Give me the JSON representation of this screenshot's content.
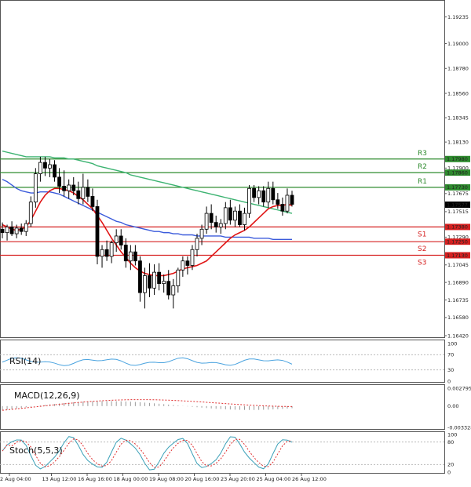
{
  "chart_data": {
    "type": "candlestick",
    "panes": {
      "price": {
        "ylim": [
          1.1642,
          1.1935
        ],
        "ticks": [
          "1.19235",
          "1.19000",
          "1.18780",
          "1.18560",
          "1.18345",
          "1.18130",
          "1.17900",
          "1.17675",
          "1.17515",
          "1.17290",
          "1.17045",
          "1.16890",
          "1.16735",
          "1.16580",
          "1.16420"
        ],
        "current": "1.17577",
        "current_value": 1.17577,
        "levels": [
          {
            "name": "R3",
            "value_label": "1.17980",
            "value": 1.1798,
            "color": "#2e8b2e"
          },
          {
            "name": "R2",
            "value_label": "1.17860",
            "value": 1.1786,
            "color": "#2e8b2e"
          },
          {
            "name": "R1",
            "value_label": "1.17730",
            "value": 1.1773,
            "color": "#2e8b2e"
          },
          {
            "name": "S1",
            "value_label": "1.17380",
            "value": 1.1738,
            "color": "#d62020"
          },
          {
            "name": "S2",
            "value_label": "1.17250",
            "value": 1.1725,
            "color": "#d62020"
          },
          {
            "name": "S3",
            "value_label": "1.17130",
            "value": 1.1713,
            "color": "#d62020"
          }
        ]
      },
      "rsi": {
        "label": "RSI(14)",
        "ticks": [
          "100",
          "70",
          "30",
          "0"
        ]
      },
      "macd": {
        "label": "MACD(12,26,9)",
        "ticks": [
          "0.002795",
          "0.00",
          "-0.003328"
        ]
      },
      "stoch": {
        "label": "Stoch(5,5,3)",
        "ticks": [
          "100",
          "80",
          "20",
          "0"
        ]
      }
    },
    "x_labels": [
      "2 Aug 04:00",
      "13 Aug 12:00",
      "16 Aug 16:00",
      "18 Aug 00:00",
      "19 Aug 08:00",
      "20 Aug 16:00",
      "23 Aug 20:00",
      "25 Aug 04:00",
      "26 Aug 12:00"
    ],
    "candles": [
      [
        1.1736,
        1.1742,
        1.1728,
        1.1733
      ],
      [
        1.1733,
        1.174,
        1.1726,
        1.1738
      ],
      [
        1.1738,
        1.1743,
        1.173,
        1.1732
      ],
      [
        1.1732,
        1.174,
        1.1728,
        1.1737
      ],
      [
        1.1737,
        1.1741,
        1.1731,
        1.1734
      ],
      [
        1.1734,
        1.1744,
        1.173,
        1.1741
      ],
      [
        1.1741,
        1.1765,
        1.1738,
        1.176
      ],
      [
        1.176,
        1.179,
        1.1755,
        1.1785
      ],
      [
        1.1785,
        1.18,
        1.1778,
        1.1795
      ],
      [
        1.1795,
        1.18,
        1.1783,
        1.179
      ],
      [
        1.179,
        1.1798,
        1.1782,
        1.1793
      ],
      [
        1.1793,
        1.1797,
        1.1778,
        1.1782
      ],
      [
        1.1782,
        1.179,
        1.1768,
        1.1774
      ],
      [
        1.1774,
        1.1788,
        1.1765,
        1.177
      ],
      [
        1.177,
        1.178,
        1.1763,
        1.1775
      ],
      [
        1.1775,
        1.1782,
        1.1766,
        1.177
      ],
      [
        1.177,
        1.1778,
        1.1758,
        1.1763
      ],
      [
        1.1763,
        1.1785,
        1.1758,
        1.1773
      ],
      [
        1.1773,
        1.178,
        1.176,
        1.1765
      ],
      [
        1.1765,
        1.1772,
        1.1752,
        1.1756
      ],
      [
        1.1756,
        1.1762,
        1.1705,
        1.1712
      ],
      [
        1.1712,
        1.1722,
        1.1702,
        1.1718
      ],
      [
        1.1718,
        1.1726,
        1.1708,
        1.1712
      ],
      [
        1.1712,
        1.1726,
        1.1706,
        1.1724
      ],
      [
        1.1724,
        1.1736,
        1.1716,
        1.173
      ],
      [
        1.173,
        1.1736,
        1.1718,
        1.1722
      ],
      [
        1.1722,
        1.1728,
        1.1702,
        1.1708
      ],
      [
        1.1708,
        1.1722,
        1.17,
        1.1716
      ],
      [
        1.1716,
        1.1722,
        1.1704,
        1.1708
      ],
      [
        1.1708,
        1.1712,
        1.1672,
        1.168
      ],
      [
        1.168,
        1.1702,
        1.1666,
        1.1695
      ],
      [
        1.1695,
        1.1706,
        1.1676,
        1.1684
      ],
      [
        1.1684,
        1.1705,
        1.1678,
        1.1698
      ],
      [
        1.1698,
        1.1706,
        1.1682,
        1.1688
      ],
      [
        1.1688,
        1.1696,
        1.168,
        1.169
      ],
      [
        1.169,
        1.17,
        1.1674,
        1.1678
      ],
      [
        1.1678,
        1.1692,
        1.1666,
        1.1686
      ],
      [
        1.1686,
        1.1702,
        1.168,
        1.17
      ],
      [
        1.17,
        1.1712,
        1.1694,
        1.1708
      ],
      [
        1.1708,
        1.1712,
        1.1696,
        1.1704
      ],
      [
        1.1704,
        1.1722,
        1.17,
        1.1718
      ],
      [
        1.1718,
        1.1732,
        1.1712,
        1.1728
      ],
      [
        1.1728,
        1.174,
        1.1722,
        1.1736
      ],
      [
        1.1736,
        1.1756,
        1.1732,
        1.175
      ],
      [
        1.175,
        1.1758,
        1.1736,
        1.1742
      ],
      [
        1.1742,
        1.1748,
        1.1733,
        1.1738
      ],
      [
        1.1738,
        1.1745,
        1.1732,
        1.1741
      ],
      [
        1.1741,
        1.176,
        1.1736,
        1.1755
      ],
      [
        1.1755,
        1.1762,
        1.174,
        1.1744
      ],
      [
        1.1744,
        1.1756,
        1.1738,
        1.1752
      ],
      [
        1.1752,
        1.1758,
        1.1738,
        1.174
      ],
      [
        1.174,
        1.1755,
        1.1735,
        1.175
      ],
      [
        1.175,
        1.1775,
        1.1746,
        1.1772
      ],
      [
        1.1772,
        1.1775,
        1.176,
        1.1764
      ],
      [
        1.1764,
        1.1774,
        1.1758,
        1.177
      ],
      [
        1.177,
        1.1774,
        1.1756,
        1.176
      ],
      [
        1.176,
        1.1778,
        1.1755,
        1.1772
      ],
      [
        1.1772,
        1.1778,
        1.1758,
        1.1762
      ],
      [
        1.1762,
        1.1768,
        1.1754,
        1.1758
      ],
      [
        1.1758,
        1.1764,
        1.1748,
        1.1752
      ],
      [
        1.1752,
        1.1772,
        1.175,
        1.1766
      ],
      [
        1.1766,
        1.177,
        1.1756,
        1.1758
      ]
    ],
    "ma_red": [
      1.174,
      1.1738,
      1.1736,
      1.1735,
      1.1736,
      1.1738,
      1.1744,
      1.1752,
      1.176,
      1.1766,
      1.177,
      1.1772,
      1.1772,
      1.1771,
      1.177,
      1.1768,
      1.1765,
      1.1762,
      1.1758,
      1.1754,
      1.1748,
      1.1742,
      1.1735,
      1.1728,
      1.1722,
      1.1716,
      1.1711,
      1.1706,
      1.1702,
      1.1699,
      1.1697,
      1.1696,
      1.1695,
      1.1695,
      1.1695,
      1.1696,
      1.1697,
      1.1699,
      1.1701,
      1.1702,
      1.1703,
      1.1704,
      1.1706,
      1.1708,
      1.1712,
      1.1716,
      1.172,
      1.1724,
      1.1728,
      1.1731,
      1.1733,
      1.1735,
      1.1738,
      1.1742,
      1.1746,
      1.175,
      1.1754,
      1.1756,
      1.1757,
      1.1757,
      1.1758,
      1.1757
    ],
    "ma_blue": [
      1.178,
      1.1778,
      1.1775,
      1.1772,
      1.177,
      1.1769,
      1.1768,
      1.1768,
      1.1769,
      1.1769,
      1.1769,
      1.1768,
      1.1767,
      1.1765,
      1.1763,
      1.1761,
      1.1759,
      1.1757,
      1.1755,
      1.1753,
      1.1751,
      1.1749,
      1.1747,
      1.1745,
      1.1743,
      1.1742,
      1.174,
      1.1739,
      1.1738,
      1.1737,
      1.1736,
      1.1735,
      1.1734,
      1.1734,
      1.1733,
      1.1733,
      1.1732,
      1.1732,
      1.1731,
      1.1731,
      1.1731,
      1.173,
      1.173,
      1.173,
      1.173,
      1.173,
      1.173,
      1.1729,
      1.1729,
      1.1729,
      1.1729,
      1.1729,
      1.1729,
      1.1728,
      1.1728,
      1.1728,
      1.1728,
      1.1727,
      1.1727,
      1.1727,
      1.1727,
      1.1727
    ],
    "ma_green": [
      1.1805,
      1.1804,
      1.1803,
      1.1802,
      1.1801,
      1.18,
      1.18,
      1.18,
      1.18,
      1.18,
      1.18,
      1.1799,
      1.1799,
      1.1799,
      1.1798,
      1.1798,
      1.1797,
      1.1796,
      1.1795,
      1.1794,
      1.1792,
      1.1791,
      1.179,
      1.1789,
      1.1788,
      1.1787,
      1.1786,
      1.1784,
      1.1783,
      1.1782,
      1.1781,
      1.178,
      1.1779,
      1.1778,
      1.1777,
      1.1776,
      1.1775,
      1.1774,
      1.1773,
      1.1772,
      1.1771,
      1.177,
      1.1769,
      1.1768,
      1.1767,
      1.1766,
      1.1765,
      1.1764,
      1.1763,
      1.1762,
      1.1761,
      1.176,
      1.1759,
      1.1758,
      1.1757,
      1.1756,
      1.1755,
      1.1754,
      1.1753,
      1.1752,
      1.1751,
      1.175
    ]
  }
}
